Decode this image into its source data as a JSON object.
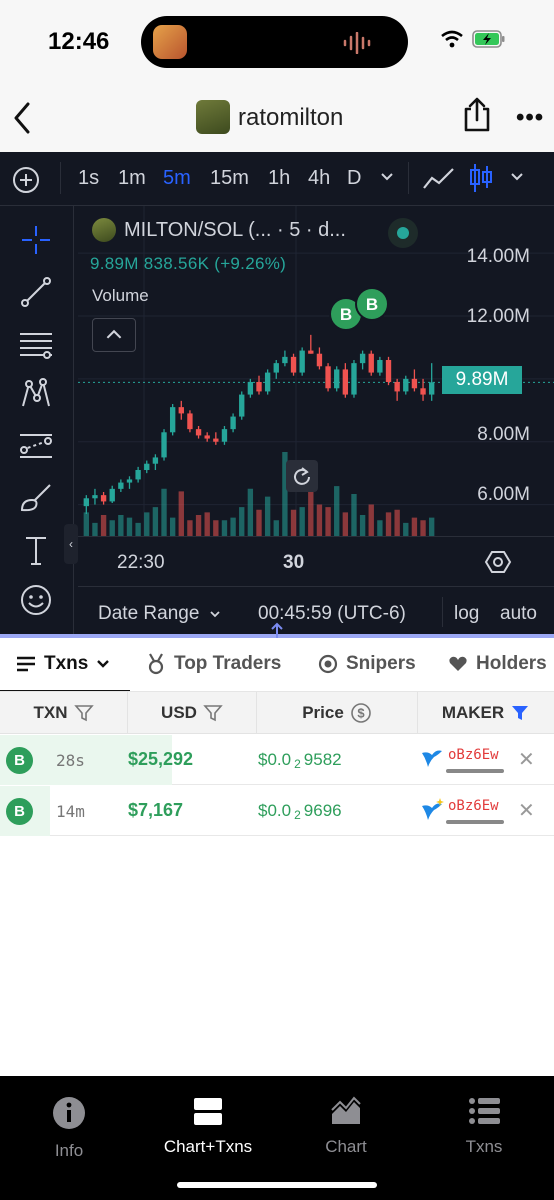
{
  "status_bar": {
    "time": "12:46"
  },
  "header": {
    "title": "ratomilton",
    "back_icon": "chevron-left-icon",
    "share_icon": "share-icon",
    "more_label": "•••"
  },
  "toolbar": {
    "intervals": [
      "1s",
      "1m",
      "5m",
      "15m",
      "1h",
      "4h",
      "D"
    ],
    "active_interval": "5m"
  },
  "legend": {
    "symbol": "MILTON/SOL (... · 5 · d...",
    "values": "9.89M  838.56K (+9.26%)",
    "volume_label": "Volume"
  },
  "chart_data": {
    "type": "candlestick",
    "y_ticks": [
      "14.00M",
      "12.00M",
      "8.00M",
      "6.00M"
    ],
    "last_price_label": "9.89M",
    "x_ticks": [
      "22:30",
      "30"
    ],
    "ylim": [
      5000000,
      15500000
    ],
    "buy_markers": [
      "B",
      "B"
    ],
    "colors": {
      "up": "#26a69a",
      "down": "#ef5350"
    },
    "candles": [
      {
        "o": 5.95,
        "h": 6.3,
        "l": 5.7,
        "c": 6.2
      },
      {
        "o": 6.2,
        "h": 6.5,
        "l": 6.0,
        "c": 6.3
      },
      {
        "o": 6.3,
        "h": 6.4,
        "l": 6.0,
        "c": 6.1
      },
      {
        "o": 6.1,
        "h": 6.6,
        "l": 6.05,
        "c": 6.5
      },
      {
        "o": 6.5,
        "h": 6.8,
        "l": 6.4,
        "c": 6.7
      },
      {
        "o": 6.7,
        "h": 6.9,
        "l": 6.5,
        "c": 6.8
      },
      {
        "o": 6.8,
        "h": 7.2,
        "l": 6.7,
        "c": 7.1
      },
      {
        "o": 7.1,
        "h": 7.4,
        "l": 7.0,
        "c": 7.3
      },
      {
        "o": 7.3,
        "h": 7.6,
        "l": 7.1,
        "c": 7.5
      },
      {
        "o": 7.5,
        "h": 8.4,
        "l": 7.4,
        "c": 8.3
      },
      {
        "o": 8.3,
        "h": 9.2,
        "l": 8.2,
        "c": 9.1
      },
      {
        "o": 9.1,
        "h": 9.3,
        "l": 8.7,
        "c": 8.9
      },
      {
        "o": 8.9,
        "h": 9.0,
        "l": 8.3,
        "c": 8.4
      },
      {
        "o": 8.4,
        "h": 8.5,
        "l": 8.1,
        "c": 8.2
      },
      {
        "o": 8.2,
        "h": 8.3,
        "l": 8.0,
        "c": 8.1
      },
      {
        "o": 8.1,
        "h": 8.3,
        "l": 7.9,
        "c": 8.0
      },
      {
        "o": 8.0,
        "h": 8.5,
        "l": 7.9,
        "c": 8.4
      },
      {
        "o": 8.4,
        "h": 8.9,
        "l": 8.3,
        "c": 8.8
      },
      {
        "o": 8.8,
        "h": 9.6,
        "l": 8.7,
        "c": 9.5
      },
      {
        "o": 9.5,
        "h": 10.0,
        "l": 9.4,
        "c": 9.9
      },
      {
        "o": 9.9,
        "h": 10.1,
        "l": 9.5,
        "c": 9.6
      },
      {
        "o": 9.6,
        "h": 10.3,
        "l": 9.5,
        "c": 10.2
      },
      {
        "o": 10.2,
        "h": 10.6,
        "l": 10.0,
        "c": 10.5
      },
      {
        "o": 10.5,
        "h": 10.9,
        "l": 10.4,
        "c": 10.7
      },
      {
        "o": 10.7,
        "h": 10.8,
        "l": 10.1,
        "c": 10.2
      },
      {
        "o": 10.2,
        "h": 11.0,
        "l": 10.1,
        "c": 10.9
      },
      {
        "o": 10.9,
        "h": 11.4,
        "l": 10.8,
        "c": 10.8
      },
      {
        "o": 10.8,
        "h": 11.0,
        "l": 10.3,
        "c": 10.4
      },
      {
        "o": 10.4,
        "h": 10.5,
        "l": 9.6,
        "c": 9.7
      },
      {
        "o": 9.7,
        "h": 10.4,
        "l": 9.6,
        "c": 10.3
      },
      {
        "o": 10.3,
        "h": 10.5,
        "l": 9.4,
        "c": 9.5
      },
      {
        "o": 9.5,
        "h": 10.6,
        "l": 9.4,
        "c": 10.5
      },
      {
        "o": 10.5,
        "h": 10.9,
        "l": 10.3,
        "c": 10.8
      },
      {
        "o": 10.8,
        "h": 10.9,
        "l": 10.1,
        "c": 10.2
      },
      {
        "o": 10.2,
        "h": 10.7,
        "l": 10.1,
        "c": 10.6
      },
      {
        "o": 10.6,
        "h": 10.7,
        "l": 9.8,
        "c": 9.9
      },
      {
        "o": 9.9,
        "h": 10.0,
        "l": 9.3,
        "c": 9.6
      },
      {
        "o": 9.6,
        "h": 10.1,
        "l": 9.5,
        "c": 10.0
      },
      {
        "o": 10.0,
        "h": 10.3,
        "l": 9.6,
        "c": 9.7
      },
      {
        "o": 9.7,
        "h": 10.0,
        "l": 9.3,
        "c": 9.5
      },
      {
        "o": 9.5,
        "h": 10.5,
        "l": 9.3,
        "c": 9.89
      }
    ],
    "volumes": [
      0.9,
      0.5,
      0.8,
      0.6,
      0.8,
      0.7,
      0.5,
      0.9,
      1.1,
      1.8,
      0.7,
      1.7,
      0.6,
      0.8,
      0.9,
      0.6,
      0.6,
      0.7,
      1.1,
      1.8,
      1.0,
      1.5,
      0.6,
      3.2,
      1.0,
      1.1,
      2.7,
      1.2,
      1.1,
      1.9,
      0.9,
      1.6,
      0.8,
      1.2,
      0.6,
      0.9,
      1.0,
      0.5,
      0.7,
      0.6,
      0.7
    ]
  },
  "bottom_controls": {
    "date_range": "Date Range",
    "clock": "00:45:59 (UTC-6)",
    "log": "log",
    "auto": "auto"
  },
  "tabs": [
    {
      "label": "Txns"
    },
    {
      "label": "Top Traders"
    },
    {
      "label": "Snipers"
    },
    {
      "label": "Holders"
    }
  ],
  "table": {
    "columns": [
      "TXN",
      "USD",
      "Price",
      "MAKER"
    ],
    "rows": [
      {
        "type": "B",
        "age": "28s",
        "usd": "$25,292",
        "price_prefix": "$0.0",
        "price_zeros": "2",
        "price_digits": "9582",
        "maker": "oBz6Ew",
        "bar_fraction": 0.31
      },
      {
        "type": "B",
        "age": "14m",
        "usd": "$7,167",
        "price_prefix": "$0.0",
        "price_zeros": "2",
        "price_digits": "9696",
        "maker": "oBz6Ew",
        "bar_fraction": 0.09
      }
    ]
  },
  "bottom_nav": [
    {
      "label": "Info",
      "icon": "info-icon"
    },
    {
      "label": "Chart+Txns",
      "icon": "split-view-icon"
    },
    {
      "label": "Chart",
      "icon": "area-chart-icon"
    },
    {
      "label": "Txns",
      "icon": "list-icon"
    }
  ]
}
